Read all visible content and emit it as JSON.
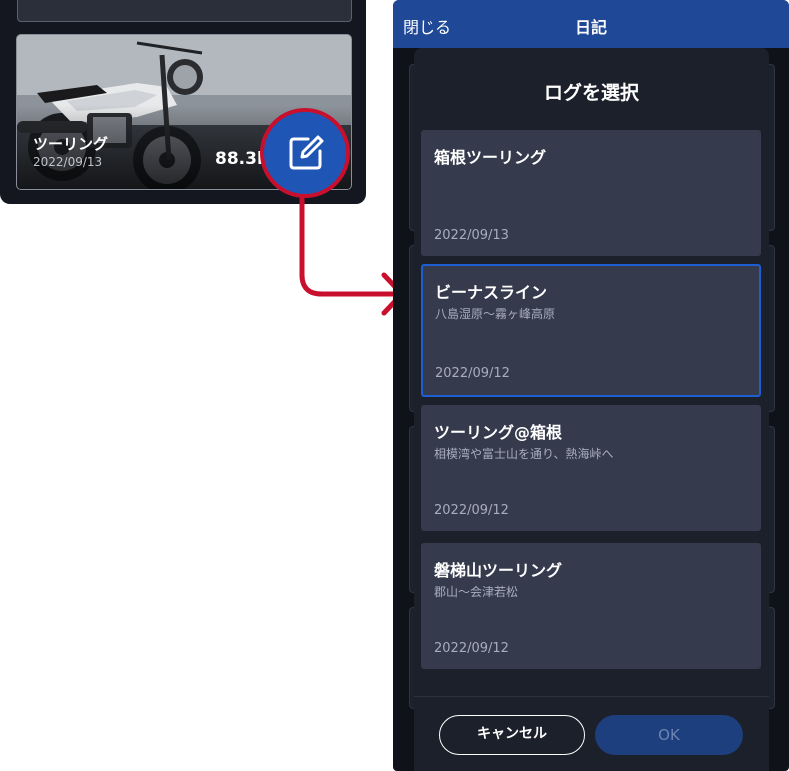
{
  "left_card": {
    "title": "ツーリング",
    "date": "2022/09/13",
    "distance": "88.3k"
  },
  "nav": {
    "close_label": "閉じる",
    "title": "日記"
  },
  "modal": {
    "title": "ログを選択",
    "items": [
      {
        "title": "箱根ツーリング",
        "subtitle": "",
        "date": "2022/09/13"
      },
      {
        "title": "ビーナスライン",
        "subtitle": "八島湿原〜霧ヶ峰高原",
        "date": "2022/09/12"
      },
      {
        "title": "ツーリング@箱根",
        "subtitle": "相模湾や富士山を通り、熱海峠へ",
        "date": "2022/09/12"
      },
      {
        "title": "磐梯山ツーリング",
        "subtitle": "郡山〜会津若松",
        "date": "2022/09/12"
      }
    ],
    "cancel_label": "キャンセル",
    "ok_label": "OK"
  },
  "colors": {
    "nav": "#1f4896",
    "accent_red": "#c8102e",
    "fab": "#1f55b5",
    "selected_border": "#1d5fd0",
    "item_bg": "#353a4d"
  },
  "icons": [
    "edit-icon",
    "arrow-right-icon"
  ]
}
